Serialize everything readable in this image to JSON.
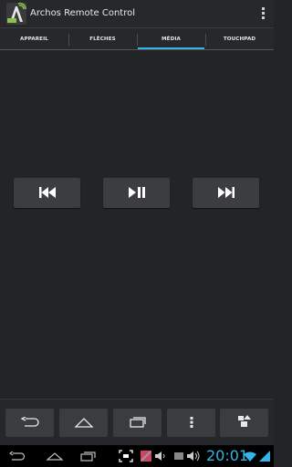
{
  "app": {
    "title": "Archos Remote Control",
    "icon": "archos-remote-app-icon"
  },
  "menu": {
    "icon": "overflow-menu-icon"
  },
  "tabs": [
    {
      "label": "APPAREIL",
      "active": false
    },
    {
      "label": "FLÈCHES",
      "active": false
    },
    {
      "label": "MÉDIA",
      "active": true
    },
    {
      "label": "TOUCHPAD",
      "active": false
    }
  ],
  "media": {
    "previous_icon": "skip-previous-icon",
    "play_pause_icon": "play-pause-icon",
    "next_icon": "skip-next-icon"
  },
  "remote_nav": {
    "back_icon": "back-icon",
    "home_icon": "home-icon",
    "recent_icon": "recent-apps-icon",
    "menu_icon": "menu-dots-icon",
    "settings_icon": "shapes-icon"
  },
  "status_bar": {
    "time": "20:01",
    "icons": [
      "back-icon",
      "home-icon",
      "recent-apps-icon",
      "screenshot-icon",
      "app-notification-icon",
      "volume-icon",
      "battery-icon",
      "volume-up-icon",
      "wifi-icon",
      "signal-icon"
    ]
  },
  "colors": {
    "accent": "#33b5e5",
    "background": "#232427",
    "button": "#3c3d41"
  }
}
